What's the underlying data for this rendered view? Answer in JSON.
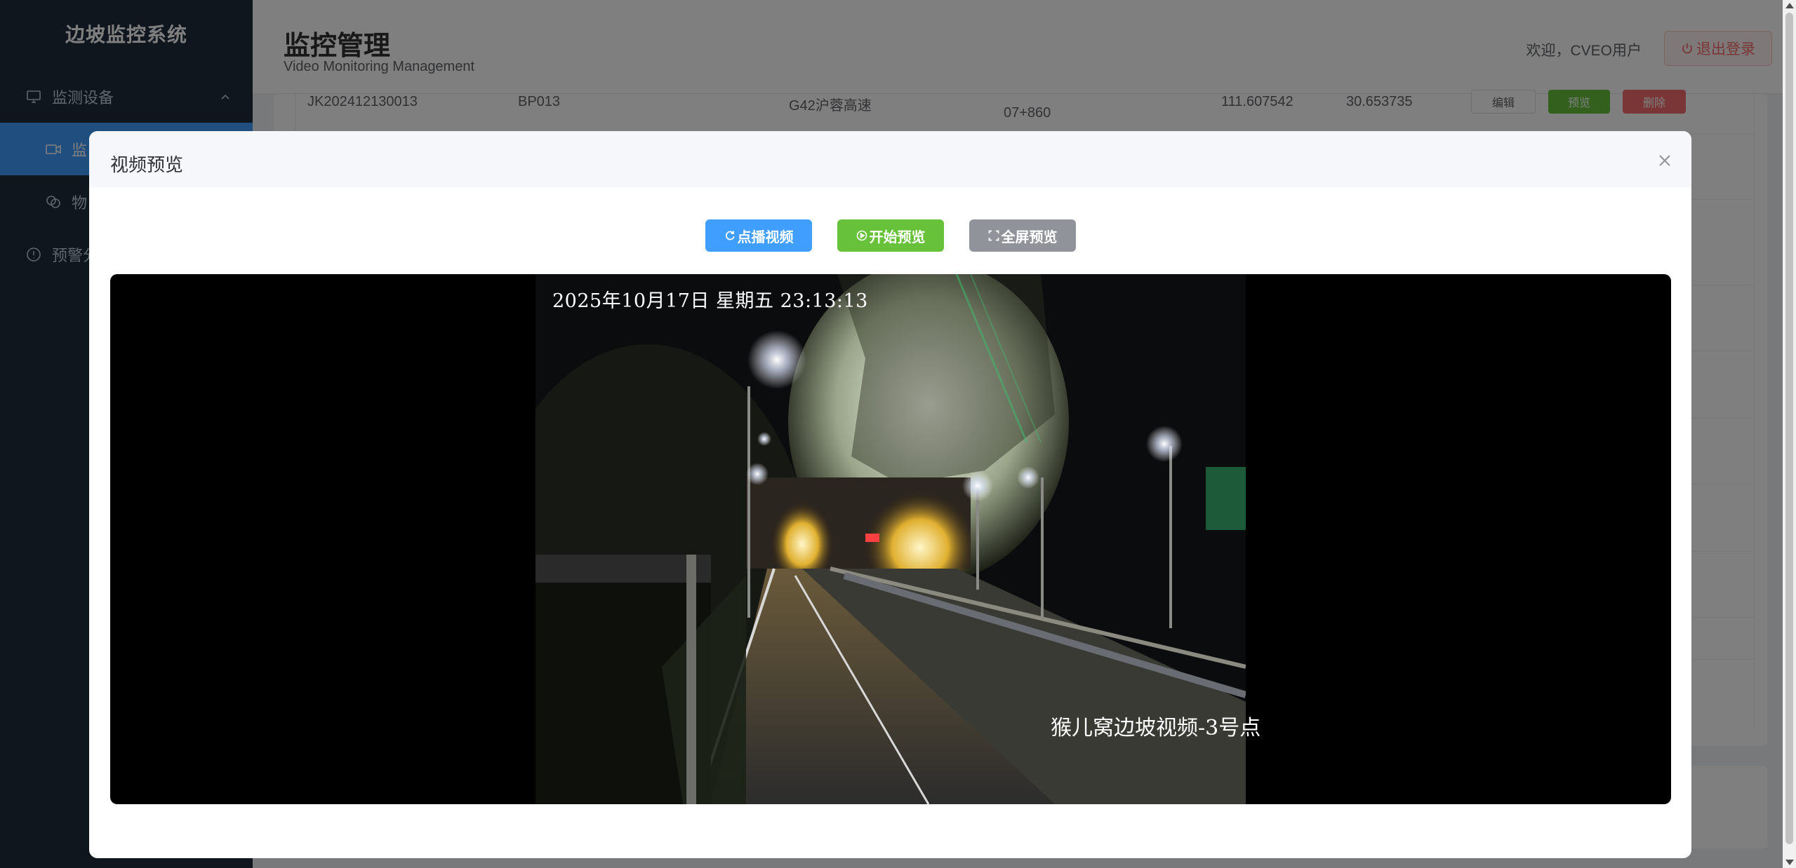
{
  "sidebar": {
    "brand": "边坡监控系统",
    "items": [
      {
        "label": "监测设备"
      },
      {
        "label": "监"
      },
      {
        "label": "物"
      },
      {
        "label": "预警分"
      }
    ]
  },
  "header": {
    "title": "监控管理",
    "subtitle": "Video Monitoring Management",
    "welcome": "欢迎，CVEO用户",
    "logout": "退出登录"
  },
  "table": {
    "row": {
      "code": "JK202412130013",
      "slope": "BP013",
      "road": "G42沪蓉高速",
      "stake": "07+860",
      "lng": "111.607542",
      "lat": "30.653735",
      "edit": "编辑",
      "preview": "预览",
      "delete": "删除"
    }
  },
  "dialog": {
    "title": "视频预览",
    "btn_vod": "点播视频",
    "btn_start": "开始预览",
    "btn_fullscreen": "全屏预览",
    "osd_time": "2025年10月17日 星期五 23:13:13",
    "osd_camera": "猴儿窝边坡视频-3号点"
  },
  "colors": {
    "sidebar_bg": "#1f2d3d",
    "primary": "#409eff",
    "success": "#67c23a",
    "info": "#909399",
    "danger": "#f56c6c"
  }
}
